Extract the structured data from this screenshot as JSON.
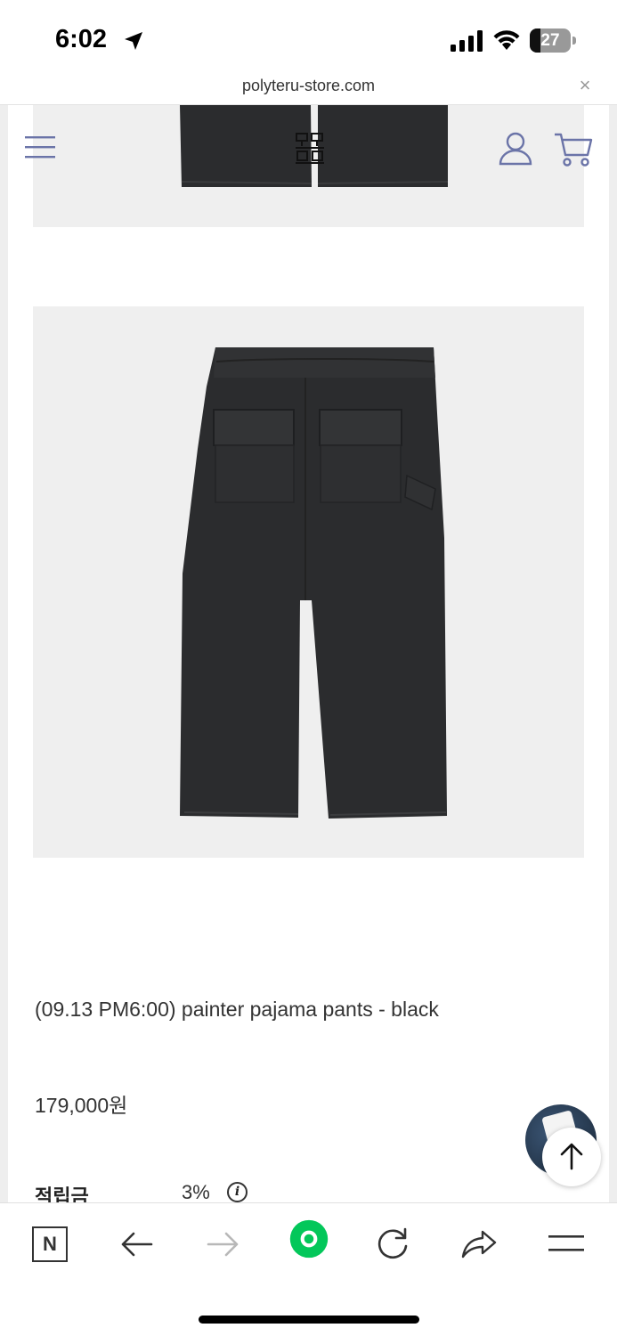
{
  "status_bar": {
    "time": "6:02",
    "battery_level": "27",
    "battery_fraction": 0.27
  },
  "url_bar": {
    "url": "polyteru-store.com",
    "close_glyph": "×"
  },
  "header": {
    "menu_icon": "hamburger-menu-icon",
    "logo": "polyteru-logo",
    "account_icon": "user-icon",
    "cart_icon": "cart-icon"
  },
  "product": {
    "name": "(09.13 PM6:00) painter pajama pants - black",
    "price": "179,000원",
    "points_label": "적립금",
    "points_value": "3%",
    "info_glyph": "i"
  },
  "floating": {
    "scroll_top_icon": "arrow-up-icon"
  },
  "toolbar": {
    "items": [
      "naver-icon",
      "back-icon",
      "forward-icon",
      "green-home-icon",
      "reload-icon",
      "share-icon",
      "menu-icon"
    ],
    "naver_letter": "N"
  },
  "colors": {
    "accent_icon": "#6b74a8",
    "image_bg": "#efefef",
    "pants": "#2b2c2e",
    "naver_green": "#03c75a"
  }
}
